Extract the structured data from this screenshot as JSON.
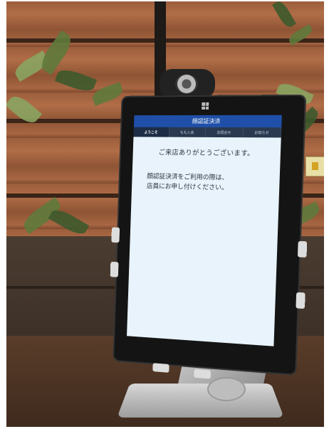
{
  "app": {
    "title": "顔認証決済"
  },
  "tabs": [
    {
      "label": "ようこそ",
      "active": true
    },
    {
      "label": "もも入会",
      "active": false
    },
    {
      "label": "お問合せ",
      "active": false
    },
    {
      "label": "お知らせ",
      "active": false
    }
  ],
  "message": {
    "greeting": "ご来店ありがとうございます。",
    "instruction_line1": "顔認証決済をご利用の際は、",
    "instruction_line2": "店員にお申し付けください。"
  },
  "colors": {
    "header_bg": "#1f4fa8",
    "tab_bar_bg": "#2a3950",
    "screen_bg": "#e8f3fb"
  }
}
